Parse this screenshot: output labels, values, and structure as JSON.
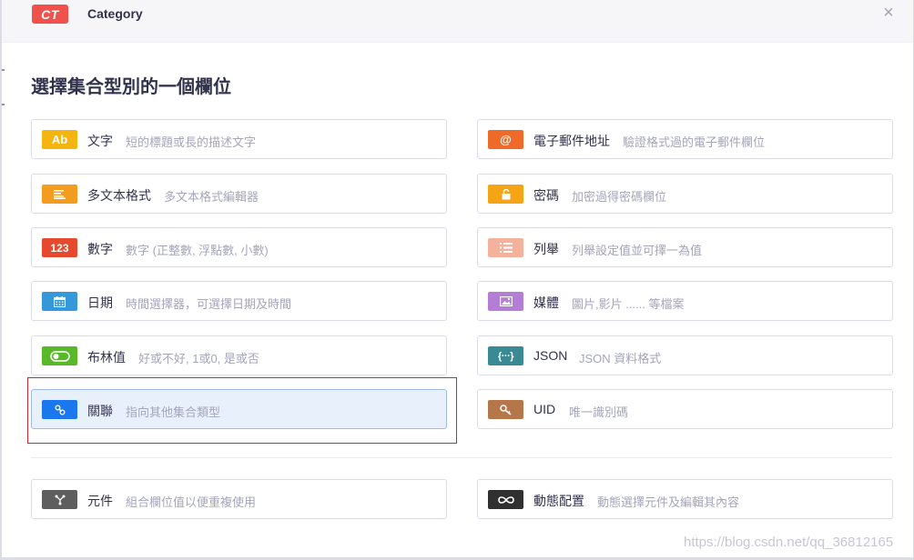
{
  "header": {
    "badge": "CT",
    "title": "Category",
    "close": "×"
  },
  "heading": "選擇集合型別的一個欄位",
  "left_cards": [
    {
      "icon": "text-icon",
      "glyph": "Ab",
      "color": "#f5b510",
      "label": "文字",
      "desc": "短的標題或長的描述文字"
    },
    {
      "icon": "richtext-icon",
      "glyph": "",
      "color": "#f29d1f",
      "label": "多文本格式",
      "desc": "多文本格式編輯器"
    },
    {
      "icon": "number-icon",
      "glyph": "123",
      "color": "#e64a2e",
      "label": "數字",
      "desc": "數字 (正整數, 浮點數, 小數)"
    },
    {
      "icon": "date-icon",
      "glyph": "",
      "color": "#3498db",
      "label": "日期",
      "desc": "時間選擇器，可選擇日期及時間"
    },
    {
      "icon": "boolean-icon",
      "glyph": "",
      "color": "#58b82a",
      "label": "布林值",
      "desc": "好或不好, 1或0, 是或否"
    },
    {
      "icon": "relation-icon",
      "glyph": "",
      "color": "#1a77ed",
      "label": "關聯",
      "desc": "指向其他集合類型"
    }
  ],
  "right_cards": [
    {
      "icon": "email-icon",
      "glyph": "@",
      "color": "#ef6a29",
      "label": "電子郵件地址",
      "desc": "驗證格式過的電子郵件欄位"
    },
    {
      "icon": "password-icon",
      "glyph": "",
      "color": "#f5a416",
      "label": "密碼",
      "desc": "加密過得密碼欄位"
    },
    {
      "icon": "enumeration-icon",
      "glyph": "",
      "color": "#f4b19b",
      "label": "列舉",
      "desc": "列舉設定值並可擇一為值"
    },
    {
      "icon": "media-icon",
      "glyph": "",
      "color": "#b47dd6",
      "label": "媒體",
      "desc": "圖片,影片 ...... 等檔案"
    },
    {
      "icon": "json-icon",
      "glyph": "{···}",
      "color": "#3a8a95",
      "label": "JSON",
      "desc": "JSON 資料格式"
    },
    {
      "icon": "uid-icon",
      "glyph": "",
      "color": "#b5774a",
      "label": "UID",
      "desc": "唯一識別碼"
    }
  ],
  "bottom_cards": [
    {
      "icon": "component-icon",
      "glyph": "",
      "color": "#5e5e5e",
      "label": "元件",
      "desc": "組合欄位值以便重複使用"
    },
    {
      "icon": "dynamiczone-icon",
      "glyph": "",
      "color": "#303030",
      "label": "動態配置",
      "desc": "動態選擇元件及編輯其內容"
    }
  ],
  "watermark": "https://blog.csdn.net/qq_36812165"
}
